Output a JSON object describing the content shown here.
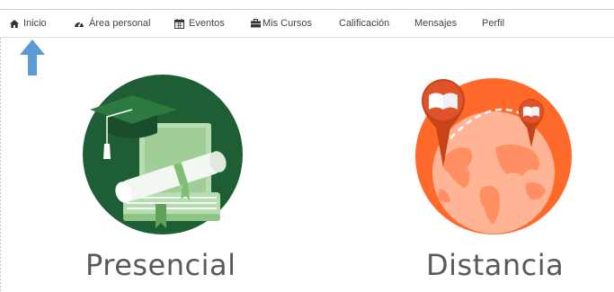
{
  "nav": {
    "items": [
      {
        "label": "Inicio",
        "icon": "home-icon"
      },
      {
        "label": "Área personal",
        "icon": "dashboard-icon"
      },
      {
        "label": "Eventos",
        "icon": "calendar-icon"
      },
      {
        "label": "Mis Cursos",
        "icon": "briefcase-icon"
      },
      {
        "label": "Calificación",
        "icon": ""
      },
      {
        "label": "Mensajes",
        "icon": ""
      },
      {
        "label": "Perfil",
        "icon": ""
      }
    ]
  },
  "cards": [
    {
      "label": "Presencial",
      "accent": "#1e5e34"
    },
    {
      "label": "Distancia",
      "accent": "#ff6a2b"
    }
  ],
  "colors": {
    "pointer_arrow": "#5b9bd5",
    "text": "#444444"
  }
}
